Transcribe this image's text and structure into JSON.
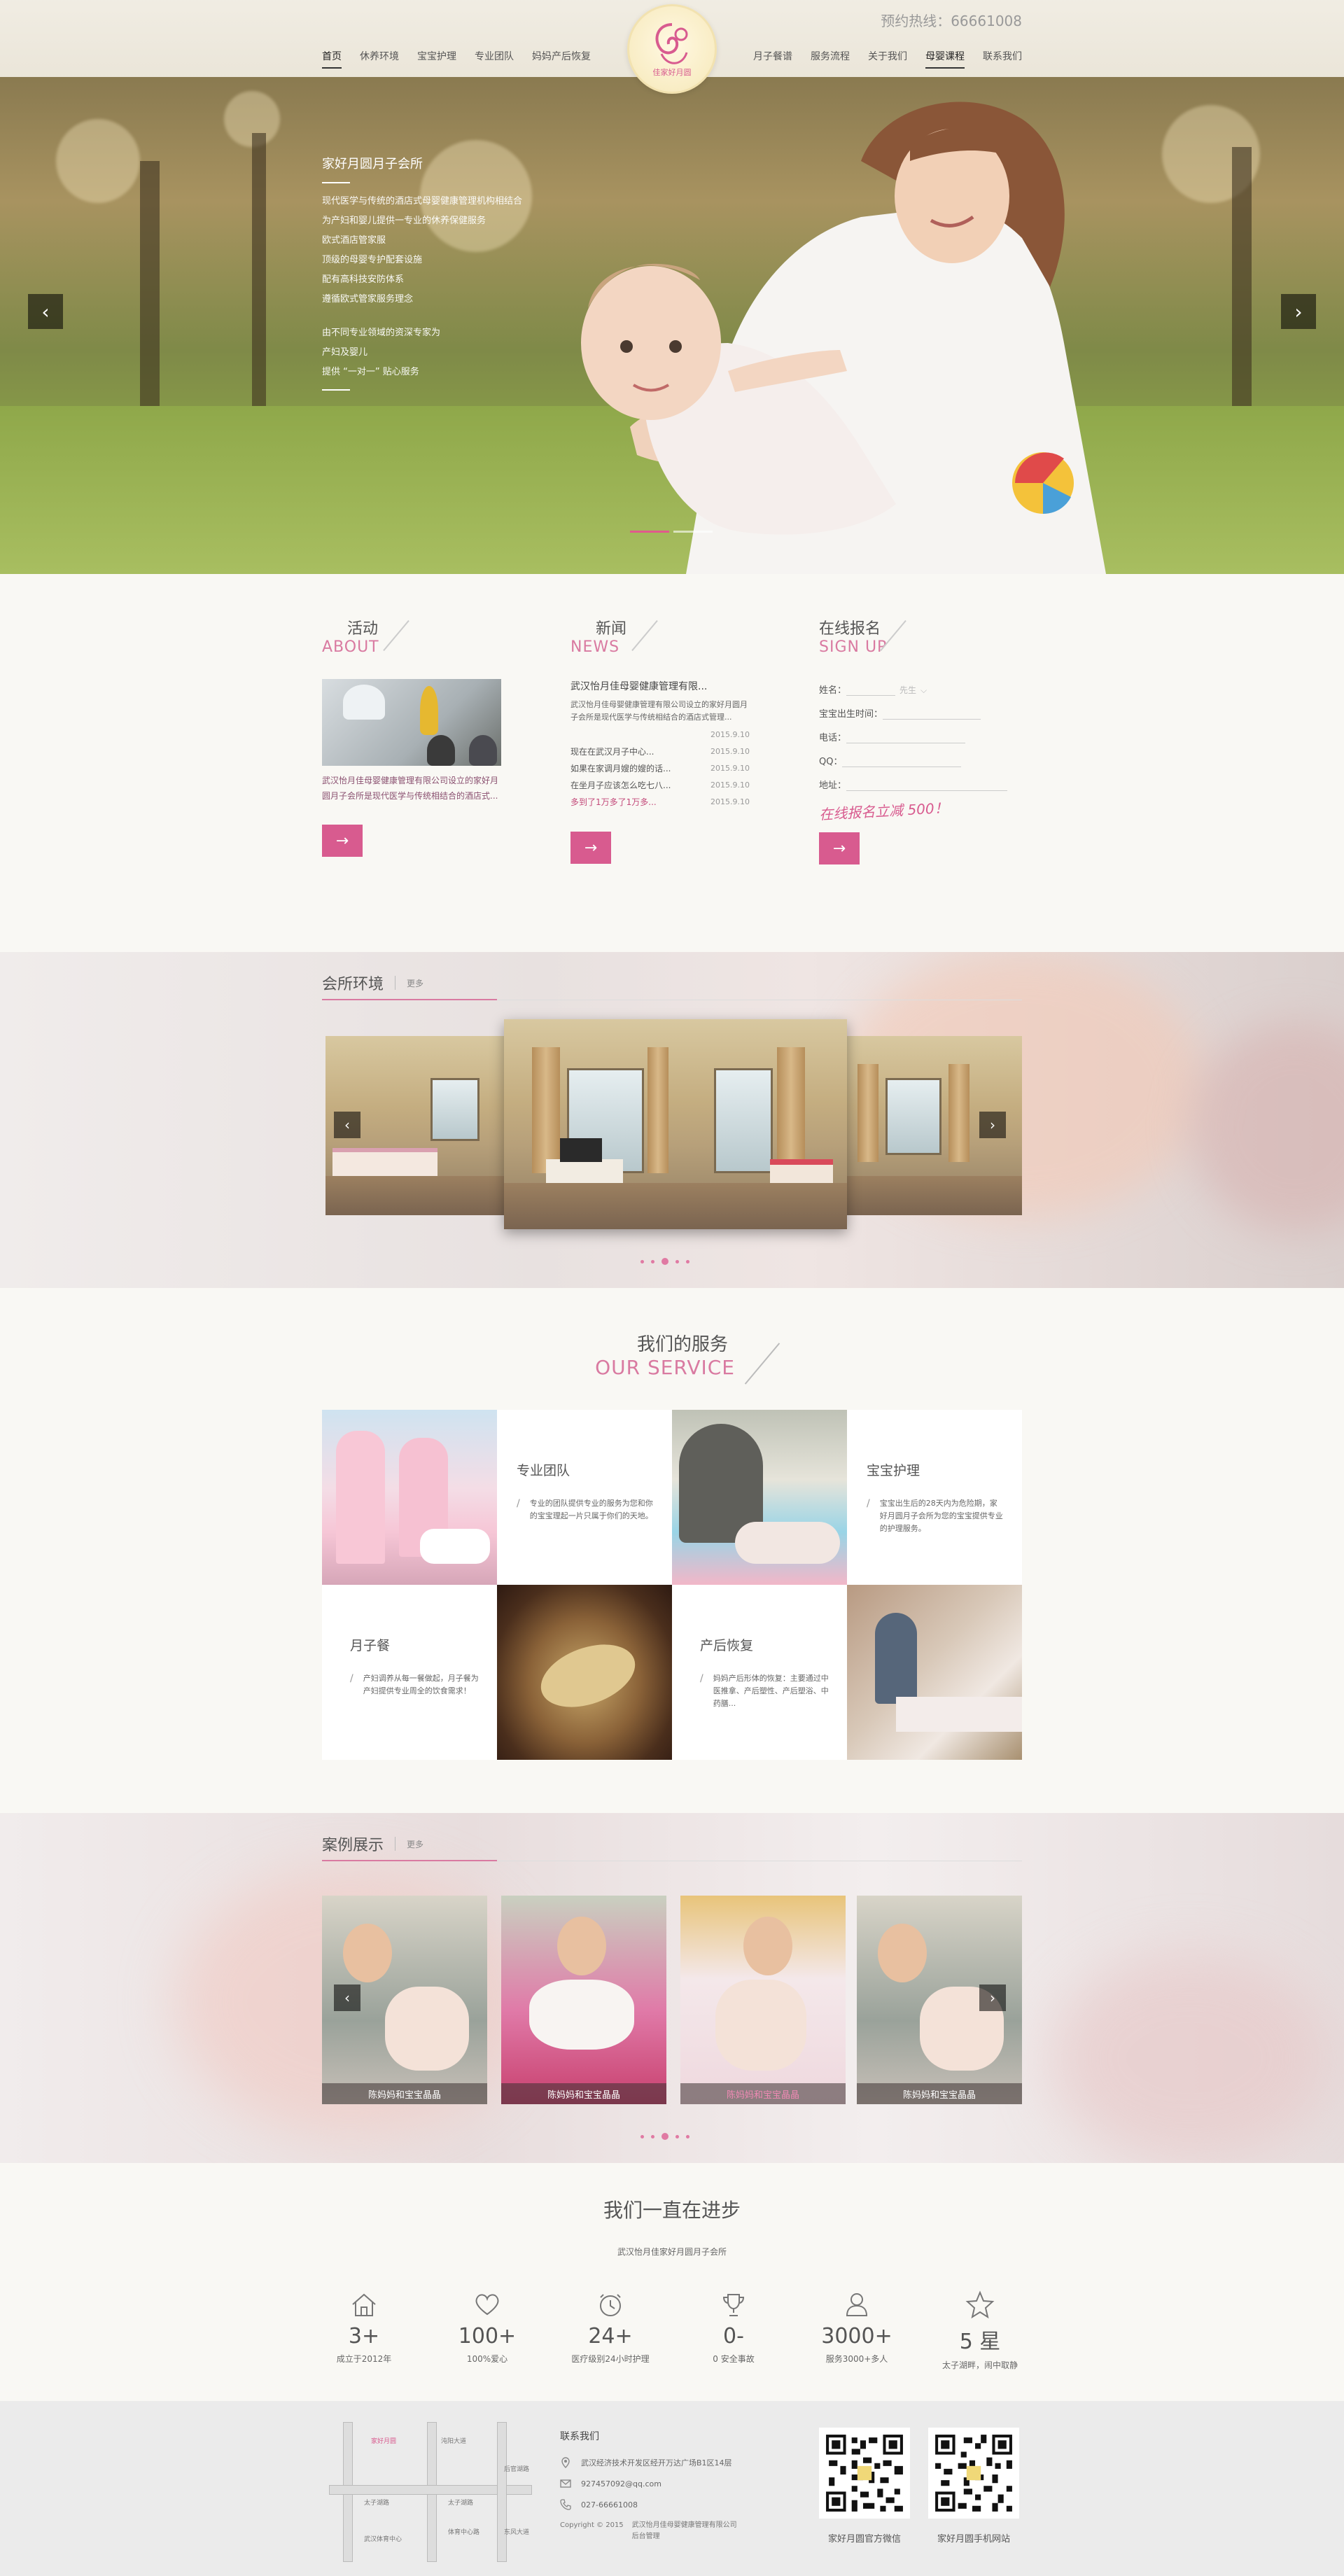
{
  "header": {
    "hotline": "预约热线：66661008",
    "nav_left": [
      "首页",
      "休养环境",
      "宝宝护理",
      "专业团队",
      "妈妈产后恢复"
    ],
    "nav_right": [
      "月子餐谱",
      "服务流程",
      "关于我们",
      "母婴课程",
      "联系我们"
    ],
    "logo_text": "佳家好月圆"
  },
  "hero": {
    "title": "家好月圆月子会所",
    "lines": [
      "现代医学与传统的酒店式母婴健康管理机构相结合",
      "为产妇和婴儿提供一专业的休养保健服务",
      "欧式酒店管家服",
      "顶级的母婴专护配套设施",
      "配有高科技安防体系",
      "遵循欧式管家服务理念"
    ],
    "lines2": [
      "由不同专业领域的资深专家为",
      "产妇及婴儿",
      "提供 “一对一” 贴心服务"
    ],
    "arrow_left": "‹",
    "arrow_right": "›"
  },
  "about": {
    "cn": "活动",
    "en": "ABOUT",
    "text": "武汉怡月佳母婴健康管理有限公司设立的家好月圆月子会所是现代医学与传统相结合的酒店式...",
    "btn": "→"
  },
  "news": {
    "cn": "新闻",
    "en": "NEWS",
    "head": "武汉怡月佳母婴健康管理有限...",
    "lead": "武汉怡月佳母婴健康管理有限公司设立的家好月圆月子会所是现代医学与传统相结合的酒店式管理...",
    "lead_date": "2015.9.10",
    "items": [
      {
        "t": "现在在武汉月子中心...",
        "d": "2015.9.10",
        "pink": false
      },
      {
        "t": "如果在家调月嫂的嫂的话...",
        "d": "2015.9.10",
        "pink": false
      },
      {
        "t": "在坐月子应该怎么吃七八...",
        "d": "2015.9.10",
        "pink": false
      },
      {
        "t": "多到了1万多了1万多...",
        "d": "2015.9.10",
        "pink": true
      }
    ],
    "btn": "→"
  },
  "signup": {
    "cn": "在线报名",
    "en": "SIGN UP",
    "fields": [
      "姓名：",
      "宝宝出生时间：",
      "电话：",
      "QQ：",
      "地址："
    ],
    "gender": "先生",
    "note": "在线报名立减 500！",
    "btn": "→"
  },
  "env": {
    "title": "会所环境",
    "more": "更多",
    "arrow_left": "‹",
    "arrow_right": "›"
  },
  "service": {
    "cn": "我们的服务",
    "en": "OUR SERVICE",
    "items": [
      {
        "title": "专业团队",
        "desc": "专业的团队提供专业的服务为您和你的宝宝理起一片只属于你们的天地。"
      },
      {
        "title": "宝宝护理",
        "desc": "宝宝出生后的28天内为危险期，家好月圆月子会所为您的宝宝提供专业的护理服务。"
      },
      {
        "title": "月子餐",
        "desc": "产妇调养从每一餐做起，月子餐为产妇提供专业周全的饮食需求！"
      },
      {
        "title": "产后恢复",
        "desc": "妈妈产后形体的恢复：主要通过中医推拿、产后塑性、产后塑浴、中药膳..."
      }
    ]
  },
  "cases": {
    "title": "案例展示",
    "more": "更多",
    "labels": [
      "陈妈妈和宝宝晶晶",
      "陈妈妈和宝宝晶晶",
      "陈妈妈和宝宝晶晶",
      "陈妈妈和宝宝晶晶"
    ],
    "arrow_left": "‹",
    "arrow_right": "›"
  },
  "progress": {
    "title": "我们一直在进步",
    "sub": "武汉怡月佳家好月圆月子会所",
    "stats": [
      {
        "icon": "house-icon",
        "num": "3+",
        "cap": "成立于2012年"
      },
      {
        "icon": "heart-icon",
        "num": "100+",
        "cap": "100%爱心"
      },
      {
        "icon": "clock-icon",
        "num": "24+",
        "cap": "医疗级别24小时护理"
      },
      {
        "icon": "trophy-icon",
        "num": "0-",
        "cap": "0 安全事故"
      },
      {
        "icon": "user-icon",
        "num": "3000+",
        "cap": "服务3000+多人"
      },
      {
        "icon": "star-icon",
        "num": "5 星",
        "cap": "太子湖畔，闹中取静"
      }
    ]
  },
  "footer": {
    "contact_title": "联系我们",
    "address": "武汉经济技术开发区经开万达广场B1区14层",
    "email": "927457092@qq.com",
    "phone": "027-66661008",
    "copyright": "Copyright © 2015",
    "company": "武汉怡月佳母婴健康管理有限公司",
    "admin": "后台管理",
    "map_labels": [
      "家好月圆",
      "太子湖路",
      "太子湖路",
      "武汉体育中心",
      "沌阳大道",
      "体育中心路",
      "后官湖路",
      "东风大道"
    ],
    "qr1": "家好月圆官方微信",
    "qr2": "家好月圆手机网站"
  },
  "colors": {
    "accent": "#d85b8f",
    "pink_text": "#d97aa1",
    "bg": "#f9f8f4"
  }
}
